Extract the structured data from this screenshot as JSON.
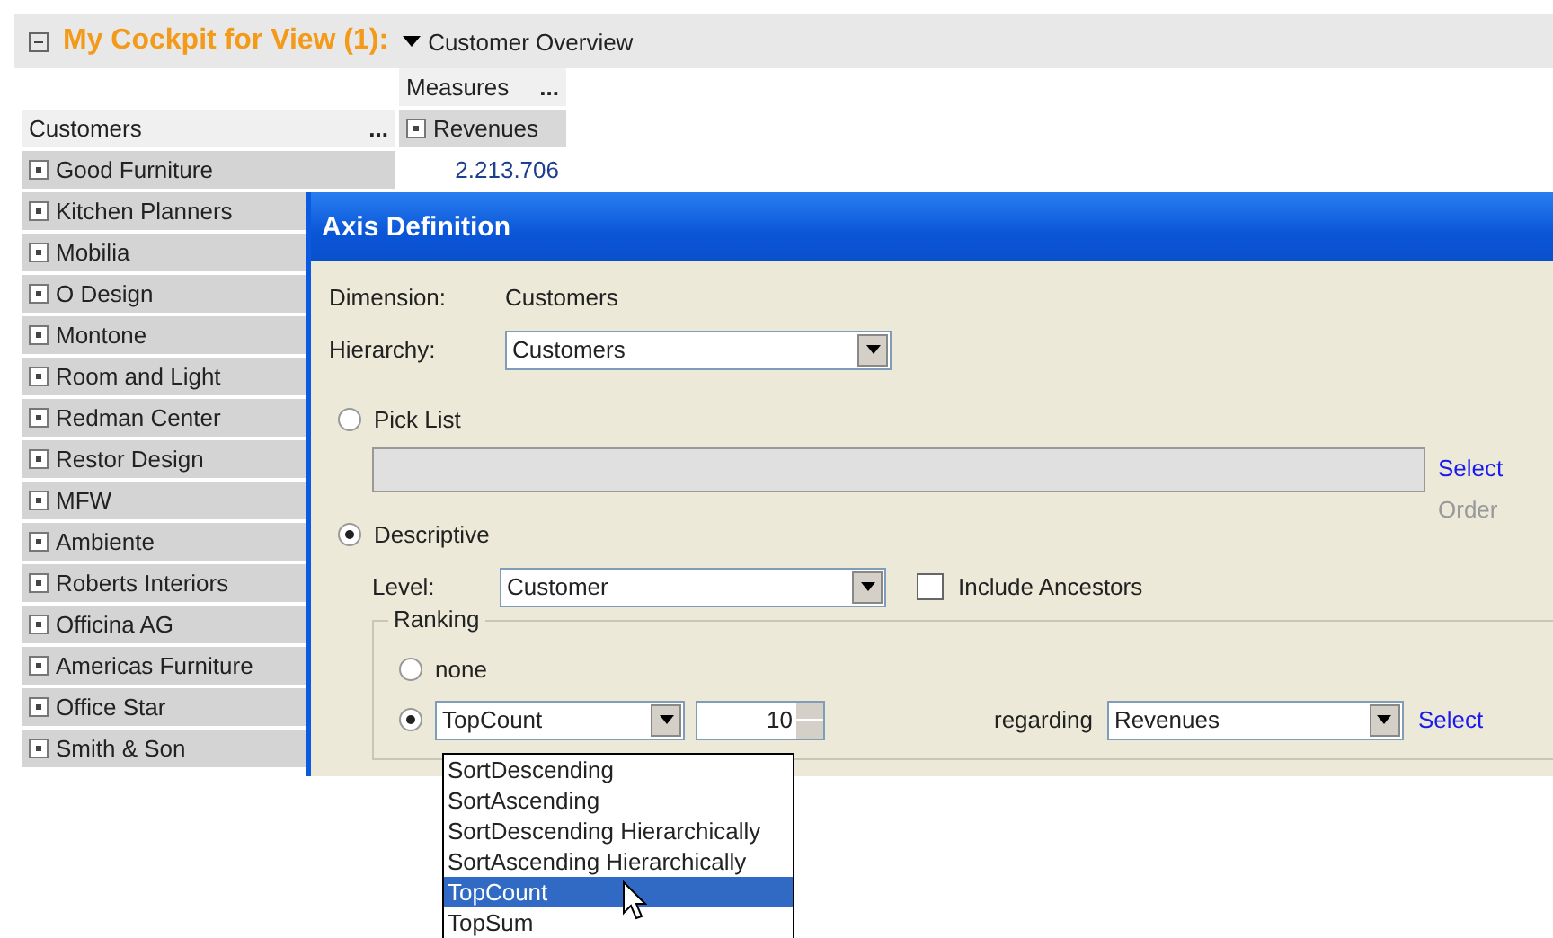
{
  "header": {
    "title": "My Cockpit for View (1):",
    "view": "Customer Overview"
  },
  "grid": {
    "measures_label": "Measures",
    "measures_more": "...",
    "dimension_label": "Customers",
    "dimension_more": "...",
    "measure": "Revenues",
    "rows": [
      {
        "name": "Good Furniture",
        "value": "2.213.706"
      },
      {
        "name": "Kitchen Planners"
      },
      {
        "name": "Mobilia"
      },
      {
        "name": "O Design"
      },
      {
        "name": "Montone"
      },
      {
        "name": "Room and Light"
      },
      {
        "name": "Redman Center"
      },
      {
        "name": "Restor Design"
      },
      {
        "name": "MFW"
      },
      {
        "name": "Ambiente"
      },
      {
        "name": "Roberts Interiors"
      },
      {
        "name": "Officina AG"
      },
      {
        "name": "Americas Furniture"
      },
      {
        "name": "Office Star"
      },
      {
        "name": "Smith & Son"
      }
    ]
  },
  "dialog": {
    "title": "Axis Definition",
    "dimension_label": "Dimension:",
    "dimension": "Customers",
    "hierarchy_label": "Hierarchy:",
    "hierarchy": "Customers",
    "modes": [
      {
        "label": "Pick List",
        "selected": false
      },
      {
        "label": "Descriptive",
        "selected": true
      }
    ],
    "pick_list_links": [
      {
        "label": "Select",
        "disabled": false
      },
      {
        "label": "Order",
        "disabled": true
      }
    ],
    "level_label": "Level:",
    "level": "Customer",
    "include_ancestors": {
      "label": "Include Ancestors",
      "checked": false
    },
    "ranking": {
      "legend": "Ranking",
      "options": [
        {
          "kind": "none",
          "label": "none",
          "selected": false
        },
        {
          "kind": "function",
          "selected": true
        }
      ],
      "function": "TopCount",
      "count": "10",
      "regarding_label": "regarding",
      "regarding": "Revenues",
      "select_link": "Select"
    }
  },
  "dropdown": {
    "items": [
      {
        "label": "SortDescending",
        "selected": false
      },
      {
        "label": "SortAscending",
        "selected": false
      },
      {
        "label": "SortDescending Hierarchically",
        "selected": false
      },
      {
        "label": "SortAscending Hierarchically",
        "selected": false
      },
      {
        "label": "TopCount",
        "selected": true
      },
      {
        "label": "TopSum",
        "selected": false
      }
    ]
  }
}
